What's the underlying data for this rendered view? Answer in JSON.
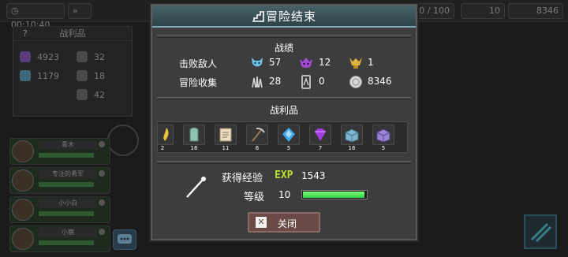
{
  "background": {
    "timer": "00:10:40",
    "resource_counter": "0 / 100",
    "gem_count": "10",
    "coin_count": "8346",
    "left_panel_title": "战利品",
    "left_panel_help": "?",
    "left_stats": [
      "4923",
      "1179",
      "32",
      "18",
      "42"
    ],
    "party": [
      "青木",
      "专注的勇军",
      "小小白",
      "小鹿"
    ]
  },
  "modal": {
    "title": "冒险结束",
    "record_title": "战绩",
    "defeated_label": "击败敌人",
    "defeated": [
      {
        "icon": "blue-demon-icon",
        "value": "57"
      },
      {
        "icon": "purple-demon-icon",
        "value": "12"
      },
      {
        "icon": "golden-boss-icon",
        "value": "1"
      }
    ],
    "collected_label": "冒险收集",
    "collected": [
      {
        "icon": "ore-cluster-icon",
        "value": "28"
      },
      {
        "icon": "card-icon",
        "value": "0"
      },
      {
        "icon": "silver-coin-icon",
        "value": "8346"
      }
    ],
    "loot_title": "战利品",
    "loot": [
      {
        "icon": "feather-icon",
        "count": "2"
      },
      {
        "icon": "green-crystal-icon",
        "count": "16"
      },
      {
        "icon": "scroll-icon",
        "count": "11"
      },
      {
        "icon": "pickaxe-icon",
        "count": "6"
      },
      {
        "icon": "blue-gem-icon",
        "count": "5"
      },
      {
        "icon": "purple-gem-icon",
        "count": "7"
      },
      {
        "icon": "crystal-box-icon",
        "count": "16"
      },
      {
        "icon": "purple-box-icon",
        "count": "5"
      }
    ],
    "exp_label": "获得经验",
    "exp_tag": "EXP",
    "exp_value": "1543",
    "level_label": "等级",
    "level_value": "10",
    "level_progress": 0.97,
    "close_label": "关闭"
  }
}
